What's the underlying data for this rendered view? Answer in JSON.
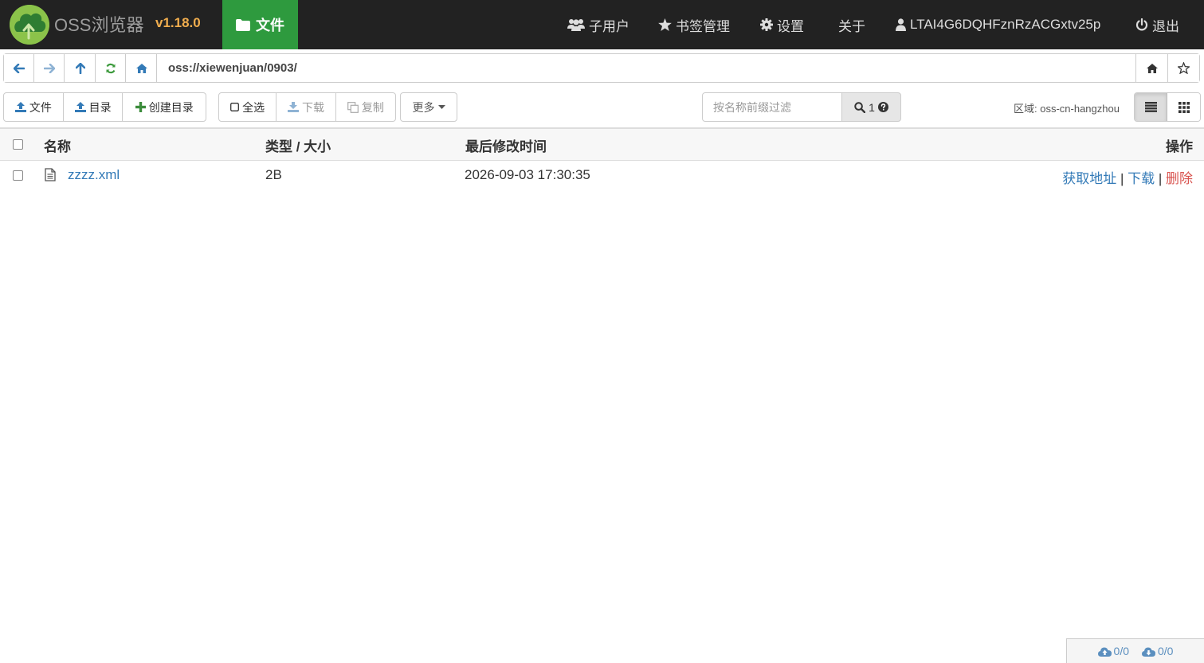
{
  "app": {
    "brand": "OSS浏览器",
    "version": "v1.18.0"
  },
  "nav": {
    "files": "文件",
    "subusers": "子用户",
    "bookmarks": "书签管理",
    "settings": "设置",
    "about": "关于",
    "account": "LTAI4G6DQHFznRzACGxtv25p",
    "logout": "退出"
  },
  "address": {
    "path": "oss://xiewenjuan/0903/"
  },
  "toolbar": {
    "upload_file": "文件",
    "upload_dir": "目录",
    "create_dir": "创建目录",
    "select_all": "全选",
    "download": "下载",
    "copy": "复制",
    "more": "更多",
    "filter_placeholder": "按名称前缀过滤",
    "filter_count": "1",
    "region": "区域: oss-cn-hangzhou"
  },
  "table": {
    "headers": {
      "name": "名称",
      "type_size": "类型 / 大小",
      "modified": "最后修改时间",
      "actions": "操作"
    },
    "rows": [
      {
        "name": "zzzz.xml",
        "size": "2B",
        "modified": "2026-09-03 17:30:35",
        "action_address": "获取地址",
        "action_download": "下载",
        "action_delete": "删除",
        "separator": "|"
      }
    ]
  },
  "footer": {
    "upload_progress": "0/0",
    "download_progress": "0/0"
  },
  "colors": {
    "navbar": "#222222",
    "active_tab": "#2e9a3e",
    "version": "#f0ad4e",
    "link": "#337ab7",
    "danger": "#d9534f",
    "logo": "#7dbd3c"
  }
}
